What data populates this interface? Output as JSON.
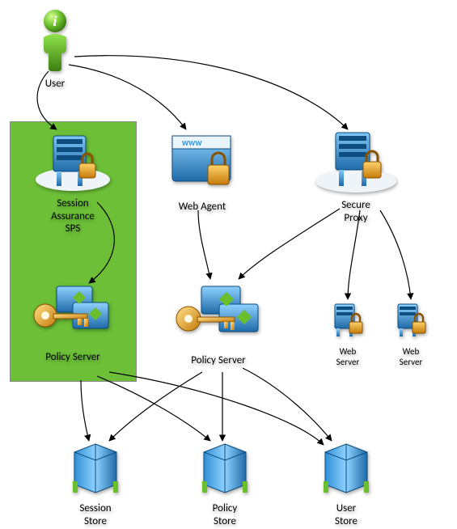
{
  "nodes": {
    "user": {
      "label": "User"
    },
    "session_sps": {
      "label": "Session\nAssurance\nSPS"
    },
    "web_agent": {
      "label": "Web Agent"
    },
    "secure_proxy": {
      "label": "Secure\nProxy"
    },
    "policy_server_l": {
      "label": "Policy Server"
    },
    "policy_server_c": {
      "label": "Policy Server"
    },
    "web_server_1": {
      "label": "Web\nServer"
    },
    "web_server_2": {
      "label": "Web\nServer"
    },
    "session_store": {
      "label": "Session\nStore"
    },
    "policy_store": {
      "label": "Policy\nStore"
    },
    "user_store": {
      "label": "User\nStore"
    }
  },
  "edges": [
    {
      "from": "user",
      "to": "session_sps"
    },
    {
      "from": "user",
      "to": "web_agent"
    },
    {
      "from": "user",
      "to": "secure_proxy"
    },
    {
      "from": "session_sps",
      "to": "policy_server_l"
    },
    {
      "from": "web_agent",
      "to": "policy_server_c"
    },
    {
      "from": "secure_proxy",
      "to": "policy_server_c"
    },
    {
      "from": "secure_proxy",
      "to": "web_server_1"
    },
    {
      "from": "secure_proxy",
      "to": "web_server_2"
    },
    {
      "from": "policy_server_l",
      "to": "session_store"
    },
    {
      "from": "policy_server_l",
      "to": "policy_store"
    },
    {
      "from": "policy_server_l",
      "to": "user_store"
    },
    {
      "from": "policy_server_c",
      "to": "session_store"
    },
    {
      "from": "policy_server_c",
      "to": "policy_store"
    },
    {
      "from": "policy_server_c",
      "to": "user_store"
    }
  ],
  "colors": {
    "highlight_box": "#6cbf37",
    "server_blue": "#2f8fd4",
    "key_gold": "#f0a818",
    "lock_gold": "#f0a818"
  }
}
